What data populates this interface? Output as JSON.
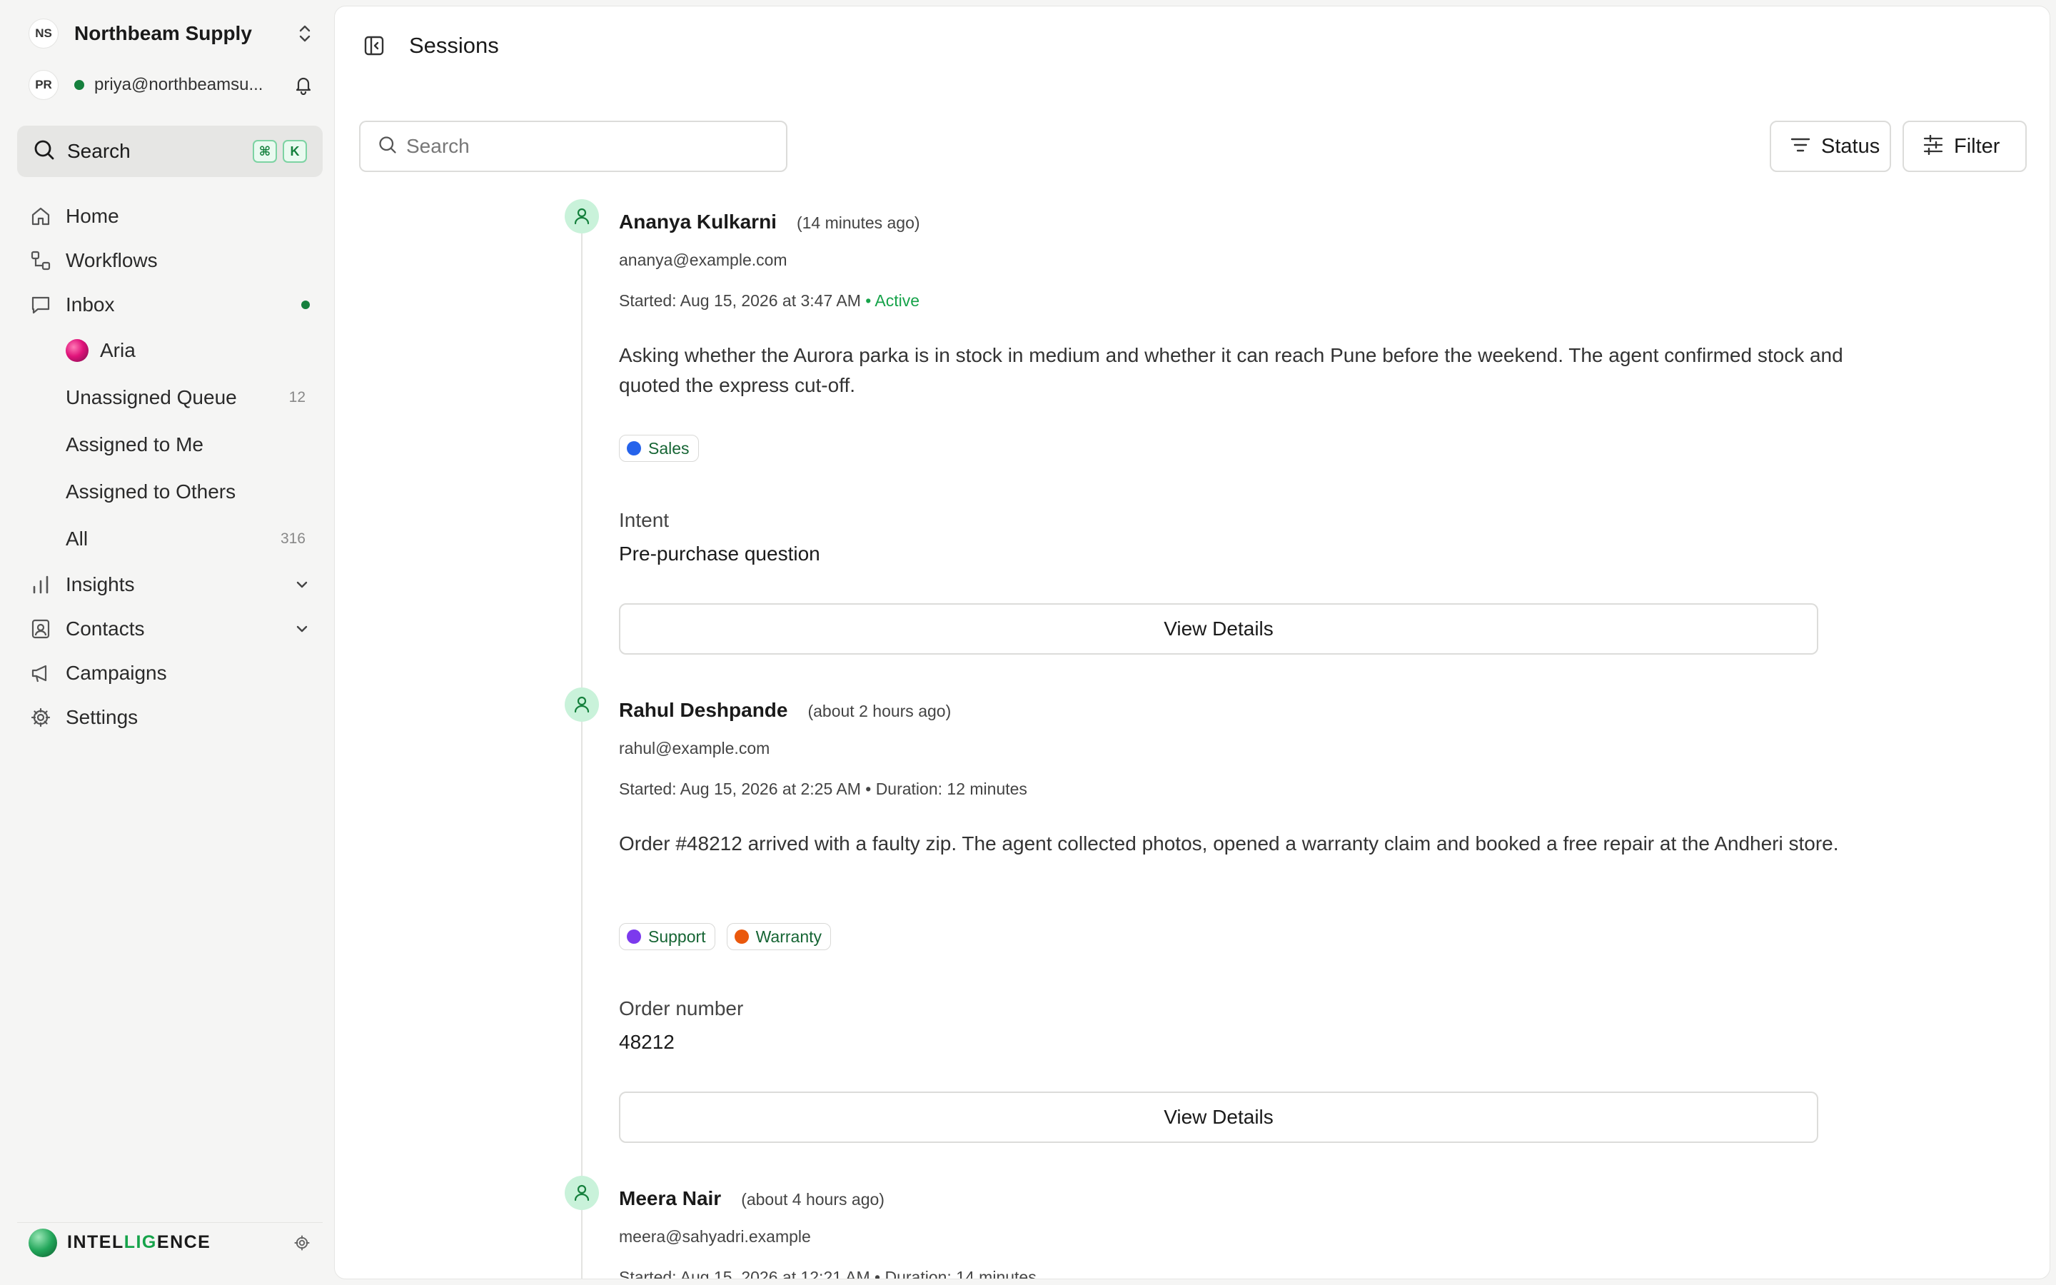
{
  "org": {
    "initials": "NS",
    "name": "Northbeam Supply"
  },
  "user": {
    "initials": "PR",
    "email": "priya@northbeamsu..."
  },
  "search": {
    "label": "Search",
    "kbd1": "⌘",
    "kbd2": "K"
  },
  "nav": {
    "home": "Home",
    "workflows": "Workflows",
    "inbox": "Inbox",
    "inbox_sub": [
      {
        "label": "Aria",
        "count": ""
      },
      {
        "label": "Unassigned Queue",
        "count": "12"
      },
      {
        "label": "Assigned to Me",
        "count": ""
      },
      {
        "label": "Assigned to Others",
        "count": ""
      },
      {
        "label": "All",
        "count": "316"
      }
    ],
    "insights": "Insights",
    "contacts": "Contacts",
    "campaigns": "Campaigns",
    "settings": "Settings"
  },
  "brand": {
    "part1": "INTEL",
    "part2": "LIG",
    "part3": "ENCE"
  },
  "main": {
    "title": "Sessions",
    "search_placeholder": "Search",
    "status_label": "Status",
    "filter_label": "Filter"
  },
  "colors": {
    "accent": "#16a34a",
    "tag_sales": "#2563eb",
    "tag_support": "#7c3aed",
    "tag_warranty": "#ea580c"
  },
  "sessions": [
    {
      "name": "Ananya Kulkarni",
      "ago": "(14 minutes ago)",
      "email": "ananya@example.com",
      "started": "Started: Aug 15, 2026 at 3:47 AM",
      "status": "• Active",
      "summary": "Asking whether the Aurora parka is in stock in medium and whether it can reach Pune before the weekend. The agent confirmed stock and quoted the express cut-off.",
      "tags": [
        "Sales"
      ],
      "field_label": "Intent",
      "field_value": "Pre-purchase question",
      "button": "View Details"
    },
    {
      "name": "Rahul Deshpande",
      "ago": "(about 2 hours ago)",
      "email": "rahul@example.com",
      "started": "Started: Aug 15, 2026 at 2:25 AM",
      "status": "• Duration: 12 minutes",
      "summary": "Order #48212 arrived with a faulty zip. The agent collected photos, opened a warranty claim and booked a free repair at the Andheri store.",
      "tags": [
        "Support",
        "Warranty"
      ],
      "field_label": "Order number",
      "field_value": "48212",
      "button": "View Details"
    },
    {
      "name": "Meera Nair",
      "ago": "(about 4 hours ago)",
      "email": "meera@sahyadri.example",
      "started": "Started: Aug 15, 2026 at 12:21 AM",
      "status": "• Duration: 14 minutes"
    }
  ]
}
